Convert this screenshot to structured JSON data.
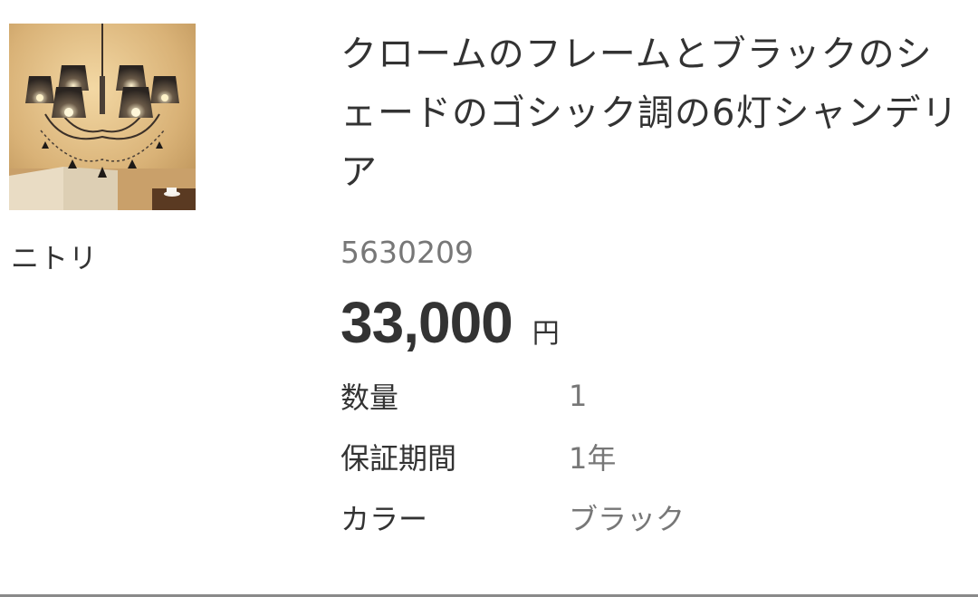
{
  "product": {
    "title": "クロームのフレームとブラックのシェードのゴシック調の6灯シャンデリア",
    "brand": "ニトリ",
    "sku": "5630209",
    "price": "33,000",
    "currency": "円",
    "image_alt": "chandelier-photo"
  },
  "specs": [
    {
      "label": "数量",
      "value": "1"
    },
    {
      "label": "保証期間",
      "value": "1年"
    },
    {
      "label": "カラー",
      "value": "ブラック"
    }
  ]
}
